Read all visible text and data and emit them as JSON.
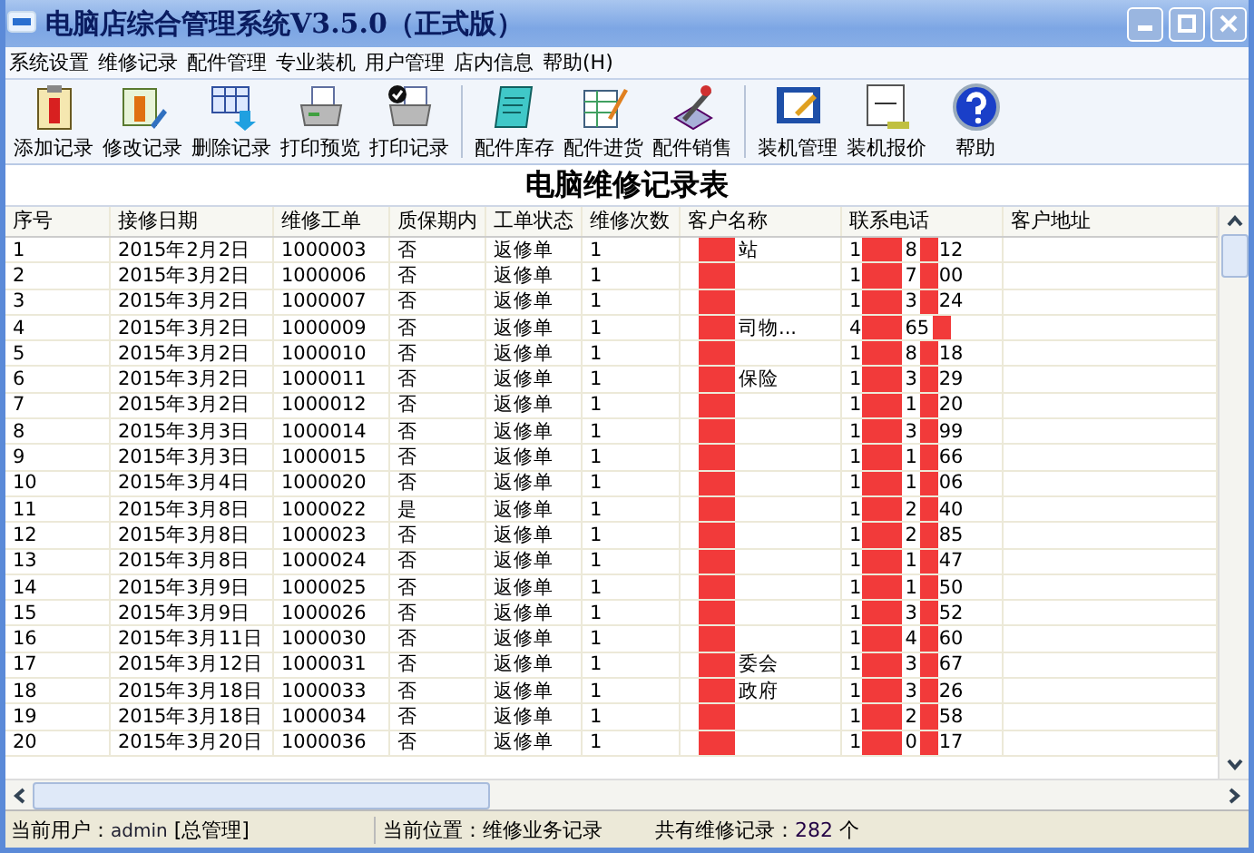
{
  "window": {
    "title": "电脑店综合管理系统V3.5.0（正式版）"
  },
  "menu": [
    "系统设置",
    "维修记录",
    "配件管理",
    "专业装机",
    "用户管理",
    "店内信息",
    "帮助(H)"
  ],
  "toolbar": [
    {
      "label": "添加记录",
      "kind": "clipboard"
    },
    {
      "label": "修改记录",
      "kind": "edit"
    },
    {
      "label": "删除记录",
      "kind": "delete"
    },
    {
      "label": "打印预览",
      "kind": "printer"
    },
    {
      "label": "打印记录",
      "kind": "printer-check",
      "separator_after": true
    },
    {
      "label": "配件库存",
      "kind": "notebook"
    },
    {
      "label": "配件进货",
      "kind": "sheet-pen"
    },
    {
      "label": "配件销售",
      "kind": "tools",
      "separator_after": true
    },
    {
      "label": "装机管理",
      "kind": "frame"
    },
    {
      "label": "装机报价",
      "kind": "calc"
    },
    {
      "label": "帮助",
      "kind": "help"
    }
  ],
  "table": {
    "title": "电脑维修记录表",
    "columns": [
      "序号",
      "接修日期",
      "维修工单",
      "质保期内",
      "工单状态",
      "维修次数",
      "客户名称",
      "联系电话",
      "客户地址"
    ],
    "rows": [
      {
        "no": "1",
        "date": "2015年2月2日",
        "order": "1000003",
        "warranty": "否",
        "status": "返修单",
        "count": "1",
        "name_tail": "站",
        "phone_head": "1",
        "phone_mid": "8",
        "phone_tail": "12"
      },
      {
        "no": "2",
        "date": "2015年3月2日",
        "order": "1000006",
        "warranty": "否",
        "status": "返修单",
        "count": "1",
        "name_tail": "",
        "phone_head": "1",
        "phone_mid": "7",
        "phone_tail": "00"
      },
      {
        "no": "3",
        "date": "2015年3月2日",
        "order": "1000007",
        "warranty": "否",
        "status": "返修单",
        "count": "1",
        "name_tail": "",
        "phone_head": "1",
        "phone_mid": "3",
        "phone_tail": "24"
      },
      {
        "no": "4",
        "date": "2015年3月2日",
        "order": "1000009",
        "warranty": "否",
        "status": "返修单",
        "count": "1",
        "name_tail": "司物...",
        "phone_head": "4",
        "phone_mid": "65",
        "phone_tail": ""
      },
      {
        "no": "5",
        "date": "2015年3月2日",
        "order": "1000010",
        "warranty": "否",
        "status": "返修单",
        "count": "1",
        "name_tail": "",
        "phone_head": "1",
        "phone_mid": "8",
        "phone_tail": "18"
      },
      {
        "no": "6",
        "date": "2015年3月2日",
        "order": "1000011",
        "warranty": "否",
        "status": "返修单",
        "count": "1",
        "name_tail": "保险",
        "phone_head": "1",
        "phone_mid": "3",
        "phone_tail": "29"
      },
      {
        "no": "7",
        "date": "2015年3月2日",
        "order": "1000012",
        "warranty": "否",
        "status": "返修单",
        "count": "1",
        "name_tail": "",
        "phone_head": "1",
        "phone_mid": "1",
        "phone_tail": "20"
      },
      {
        "no": "8",
        "date": "2015年3月3日",
        "order": "1000014",
        "warranty": "否",
        "status": "返修单",
        "count": "1",
        "name_tail": "",
        "phone_head": "1",
        "phone_mid": "3",
        "phone_tail": "99"
      },
      {
        "no": "9",
        "date": "2015年3月3日",
        "order": "1000015",
        "warranty": "否",
        "status": "返修单",
        "count": "1",
        "name_tail": "",
        "phone_head": "1",
        "phone_mid": "1",
        "phone_tail": "66"
      },
      {
        "no": "10",
        "date": "2015年3月4日",
        "order": "1000020",
        "warranty": "否",
        "status": "返修单",
        "count": "1",
        "name_tail": "",
        "phone_head": "1",
        "phone_mid": "1",
        "phone_tail": "06"
      },
      {
        "no": "11",
        "date": "2015年3月8日",
        "order": "1000022",
        "warranty": "是",
        "status": "返修单",
        "count": "1",
        "name_tail": "",
        "phone_head": "1",
        "phone_mid": "2",
        "phone_tail": "40"
      },
      {
        "no": "12",
        "date": "2015年3月8日",
        "order": "1000023",
        "warranty": "否",
        "status": "返修单",
        "count": "1",
        "name_tail": "",
        "phone_head": "1",
        "phone_mid": "2",
        "phone_tail": "85"
      },
      {
        "no": "13",
        "date": "2015年3月8日",
        "order": "1000024",
        "warranty": "否",
        "status": "返修单",
        "count": "1",
        "name_tail": "",
        "phone_head": "1",
        "phone_mid": "1",
        "phone_tail": "47"
      },
      {
        "no": "14",
        "date": "2015年3月9日",
        "order": "1000025",
        "warranty": "否",
        "status": "返修单",
        "count": "1",
        "name_tail": "",
        "phone_head": "1",
        "phone_mid": "1",
        "phone_tail": "50"
      },
      {
        "no": "15",
        "date": "2015年3月9日",
        "order": "1000026",
        "warranty": "否",
        "status": "返修单",
        "count": "1",
        "name_tail": "",
        "phone_head": "1",
        "phone_mid": "3",
        "phone_tail": "52"
      },
      {
        "no": "16",
        "date": "2015年3月11日",
        "order": "1000030",
        "warranty": "否",
        "status": "返修单",
        "count": "1",
        "name_tail": "",
        "phone_head": "1",
        "phone_mid": "4",
        "phone_tail": "60"
      },
      {
        "no": "17",
        "date": "2015年3月12日",
        "order": "1000031",
        "warranty": "否",
        "status": "返修单",
        "count": "1",
        "name_tail": "委会",
        "phone_head": "1",
        "phone_mid": "3",
        "phone_tail": "67"
      },
      {
        "no": "18",
        "date": "2015年3月18日",
        "order": "1000033",
        "warranty": "否",
        "status": "返修单",
        "count": "1",
        "name_tail": "政府",
        "phone_head": "1",
        "phone_mid": "3",
        "phone_tail": "26"
      },
      {
        "no": "19",
        "date": "2015年3月18日",
        "order": "1000034",
        "warranty": "否",
        "status": "返修单",
        "count": "1",
        "name_tail": "",
        "phone_head": "1",
        "phone_mid": "2",
        "phone_tail": "58"
      },
      {
        "no": "20",
        "date": "2015年3月20日",
        "order": "1000036",
        "warranty": "否",
        "status": "返修单",
        "count": "1",
        "name_tail": "",
        "phone_head": "1",
        "phone_mid": "0",
        "phone_tail": "17"
      }
    ]
  },
  "status_bar": {
    "user_label": "当前用户：",
    "user": "admin",
    "role": "[总管理]",
    "location": "当前位置：维修业务记录",
    "total_label": "共有维修记录：",
    "total": "282",
    "total_unit": "个"
  }
}
